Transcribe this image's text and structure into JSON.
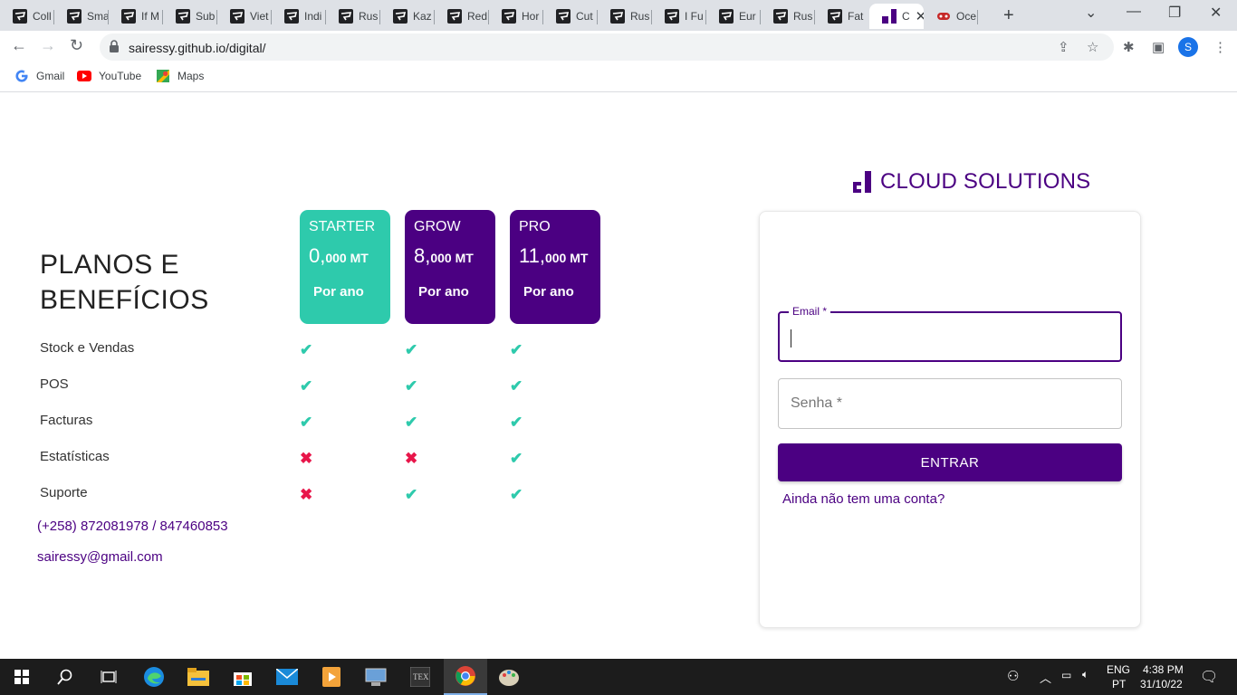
{
  "browser": {
    "tabs": [
      {
        "label": "Coll"
      },
      {
        "label": "Sma"
      },
      {
        "label": "If M"
      },
      {
        "label": "Sub"
      },
      {
        "label": "Viet"
      },
      {
        "label": "Indi"
      },
      {
        "label": "Rus"
      },
      {
        "label": "Kaz"
      },
      {
        "label": "Red"
      },
      {
        "label": "Hor"
      },
      {
        "label": "Cut"
      },
      {
        "label": "Rus"
      },
      {
        "label": "I Fu"
      },
      {
        "label": "Eur"
      },
      {
        "label": "Rus"
      },
      {
        "label": "Fat"
      },
      {
        "label": "C"
      },
      {
        "label": "Oce"
      }
    ],
    "url": "sairessy.github.io/digital/",
    "bookmarks": [
      "Gmail",
      "YouTube",
      "Maps"
    ],
    "profile_initial": "S"
  },
  "plans": {
    "title": "PLANOS E BENEFÍCIOS",
    "cards": [
      {
        "name": "STARTER",
        "price_major": "0,",
        "price_minor": "000 MT",
        "period": "Por ano",
        "color": "#2ecaac"
      },
      {
        "name": "GROW",
        "price_major": "8,",
        "price_minor": "000 MT",
        "period": "Por ano",
        "color": "#4b0082"
      },
      {
        "name": "PRO",
        "price_major": "11,",
        "price_minor": "000 MT",
        "period": "Por ano",
        "color": "#4b0082"
      }
    ],
    "features": [
      {
        "label": "Stock e Vendas",
        "starter": true,
        "grow": true,
        "pro": true
      },
      {
        "label": "POS",
        "starter": true,
        "grow": true,
        "pro": true
      },
      {
        "label": "Facturas",
        "starter": true,
        "grow": true,
        "pro": true
      },
      {
        "label": "Estatísticas",
        "starter": false,
        "grow": false,
        "pro": true
      },
      {
        "label": "Suporte",
        "starter": false,
        "grow": true,
        "pro": true
      }
    ],
    "check_glyph": "✔",
    "cross_glyph": "✖",
    "phone": "(+258) 872081978 / 847460853",
    "email": "sairessy@gmail.com"
  },
  "login": {
    "brand": "CLOUD SOLUTIONS",
    "email_label": "Email *",
    "password_label": "Senha *",
    "button": "ENTRAR",
    "signup_link": "Ainda não tem uma conta?"
  },
  "taskbar": {
    "lang_top": "ENG",
    "lang_bottom": "PT",
    "time": "4:38 PM",
    "date": "31/10/22"
  },
  "colors": {
    "brand_purple": "#4b0082",
    "accent_teal": "#2ecaac",
    "cross_red": "#e8164a"
  }
}
